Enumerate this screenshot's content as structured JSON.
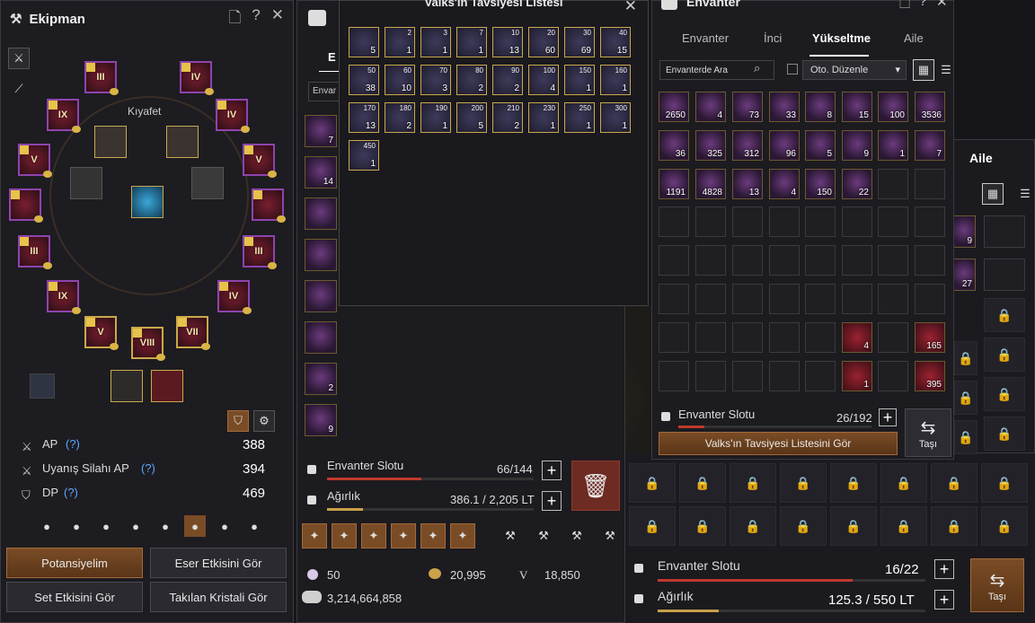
{
  "equipment": {
    "title": "Ekipman",
    "costume_label": "Kıyafet",
    "gear_ring": [
      "III",
      "IV",
      "IX",
      "IV",
      "V",
      "V",
      "",
      "",
      "III",
      "III",
      "IX",
      "IV",
      "V",
      "VII",
      "VIII"
    ],
    "stats": [
      {
        "label": "AP",
        "help": "(?)",
        "value": "388"
      },
      {
        "label": "Uyanış Silahı AP",
        "help": "(?)",
        "value": "394"
      },
      {
        "label": "DP",
        "help": "(?)",
        "value": "469"
      }
    ],
    "buttons": {
      "potential": "Potansiyelim",
      "artifact": "Eser Etkisini Gör",
      "set": "Set Etkisini Gör",
      "crystal": "Takılan Kristali Gör"
    }
  },
  "valks": {
    "title": "Valks'ın Tavsiyesi Listesi",
    "items": [
      {
        "lvl": "",
        "cnt": "5"
      },
      {
        "lvl": "2",
        "cnt": "1"
      },
      {
        "lvl": "3",
        "cnt": "1"
      },
      {
        "lvl": "7",
        "cnt": "1"
      },
      {
        "lvl": "10",
        "cnt": "13"
      },
      {
        "lvl": "20",
        "cnt": "60"
      },
      {
        "lvl": "30",
        "cnt": "69"
      },
      {
        "lvl": "40",
        "cnt": "15"
      },
      {
        "lvl": "50",
        "cnt": "38"
      },
      {
        "lvl": "60",
        "cnt": "10"
      },
      {
        "lvl": "70",
        "cnt": "3"
      },
      {
        "lvl": "80",
        "cnt": "2"
      },
      {
        "lvl": "90",
        "cnt": "2"
      },
      {
        "lvl": "100",
        "cnt": "4"
      },
      {
        "lvl": "150",
        "cnt": "1"
      },
      {
        "lvl": "160",
        "cnt": "1"
      },
      {
        "lvl": "170",
        "cnt": "13"
      },
      {
        "lvl": "180",
        "cnt": "2"
      },
      {
        "lvl": "190",
        "cnt": "1"
      },
      {
        "lvl": "200",
        "cnt": "5"
      },
      {
        "lvl": "210",
        "cnt": "2"
      },
      {
        "lvl": "230",
        "cnt": "1"
      },
      {
        "lvl": "250",
        "cnt": "1"
      },
      {
        "lvl": "300",
        "cnt": "1"
      },
      {
        "lvl": "450",
        "cnt": "1"
      }
    ]
  },
  "left_inventory": {
    "tab_label": "E",
    "search_placeholder": "Envar",
    "item_counts": [
      "7",
      "14",
      "",
      "",
      "",
      "",
      "2",
      "9"
    ],
    "slot_label": "Envanter Slotu",
    "slot_value": "66/144",
    "weight_label": "Ağırlık",
    "weight_value": "386.1 / 2,205 LT",
    "silver_small": "50",
    "coin_value": "20,995",
    "v_label": "V",
    "v_value": "18,850",
    "silver_total": "3,214,664,858",
    "slot_fill": 0.458,
    "weight_fill": 0.175
  },
  "inventory": {
    "title": "Envanter",
    "tabs": [
      "Envanter",
      "İnci",
      "Yükseltme",
      "Aile"
    ],
    "active_tab": "Yükseltme",
    "search_placeholder": "Envanterde Ara",
    "auto_sort": "Oto. Düzenle",
    "items": [
      "2650",
      "4",
      "73",
      "33",
      "8",
      "15",
      "100",
      "3536",
      "36",
      "325",
      "312",
      "96",
      "5",
      "9",
      "1",
      "7",
      "1191",
      "4828",
      "13",
      "4",
      "150",
      "22"
    ],
    "bottom_items": [
      "4",
      "165",
      "1",
      "395"
    ],
    "slot_label": "Envanter Slotu",
    "slot_value": "26/192",
    "valks_button": "Valks'ın Tavsiyesi Listesini Gör",
    "transfer_label": "Taşı",
    "slot_fill": 0.135
  },
  "right_panel": {
    "tab_label": "Aile",
    "counts": [
      "9",
      "27"
    ],
    "slot_label": "Envanter Slotu",
    "slot_value": "16/22",
    "weight_label": "Ağırlık",
    "weight_value": "125.3 / 550 LT",
    "transfer_label": "Taşı",
    "slot_fill": 0.727,
    "weight_fill": 0.228
  },
  "colors": {
    "accent_orange": "#a36a3a",
    "bar_red": "#c0392b",
    "gold": "#e6c34a"
  }
}
